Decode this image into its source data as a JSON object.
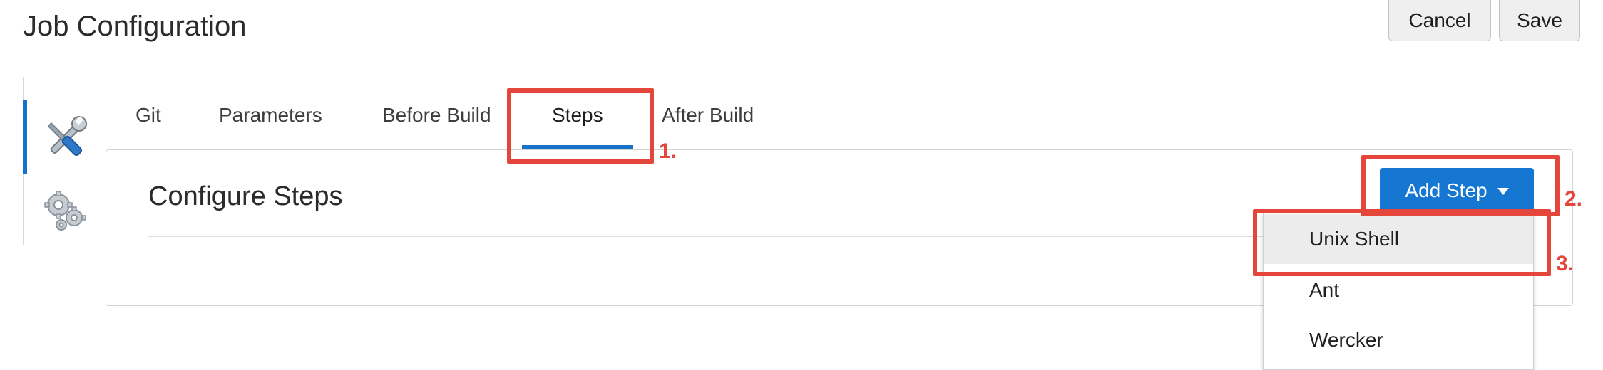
{
  "header": {
    "title": "Job Configuration",
    "cancel_label": "Cancel",
    "save_label": "Save"
  },
  "sidebar": {
    "items": [
      {
        "icon": "tools-icon",
        "active": true
      },
      {
        "icon": "gears-icon",
        "active": false
      }
    ]
  },
  "tabs": [
    "Git",
    "Parameters",
    "Before Build",
    "Steps",
    "After Build"
  ],
  "active_tab": "Steps",
  "panel": {
    "title": "Configure Steps",
    "add_step_label": "Add Step"
  },
  "dropdown": {
    "items": [
      "Unix Shell",
      "Ant",
      "Wercker"
    ],
    "highlighted": "Unix Shell"
  },
  "annotations": [
    "1.",
    "2.",
    "3."
  ],
  "colors": {
    "accent": "#1773c9",
    "button_primary": "#1577d2",
    "annotation": "#e5463c"
  }
}
